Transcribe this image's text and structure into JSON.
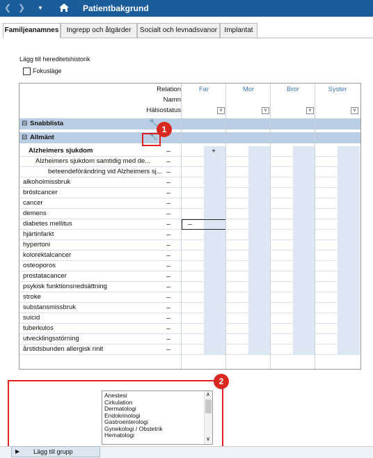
{
  "window": {
    "title": "Patientbakgrund"
  },
  "tabs": [
    {
      "label": "Familjeanamnes",
      "active": true
    },
    {
      "label": "Ingrepp och åtgärder"
    },
    {
      "label": "Socialt och levnadsvanor"
    },
    {
      "label": "Implantat"
    }
  ],
  "main": {
    "add_history_label": "Lägg till hereditetshistorik",
    "focus_mode_label": "Fokusläge"
  },
  "grid": {
    "header_labels": {
      "relation": "Relation",
      "name": "Namn",
      "health": "Hälsostatus"
    },
    "relations": [
      "Far",
      "Mor",
      "Bror",
      "Syster"
    ],
    "groups": {
      "quicklist": "Snabblista",
      "general": "Allmänt"
    },
    "rows": [
      {
        "label": "Alzheimers sjukdom",
        "bold": true,
        "indent": 0,
        "mark": "–",
        "far": "+"
      },
      {
        "label": "Alzheimers sjukdom samtidig med de...",
        "indent": 1,
        "mark": "–"
      },
      {
        "label": "beteendeförändring vid Alzheimers sj...",
        "indent": 2,
        "mark": "–"
      },
      {
        "label": "alkoholmissbruk",
        "mark": "–"
      },
      {
        "label": "bröstcancer",
        "mark": "–"
      },
      {
        "label": "cancer",
        "mark": "–"
      },
      {
        "label": "demens",
        "mark": "–"
      },
      {
        "label": "diabetes mellitus",
        "mark": "–",
        "far": "–",
        "selected": true
      },
      {
        "label": "hjärtinfarkt",
        "mark": "–"
      },
      {
        "label": "hypertoni",
        "mark": "–"
      },
      {
        "label": "kolorektalcancer",
        "mark": "–"
      },
      {
        "label": "osteoporos",
        "mark": "–"
      },
      {
        "label": "prostatacancer",
        "mark": "–"
      },
      {
        "label": "psykisk funktionsnedsättning",
        "mark": "–"
      },
      {
        "label": "stroke",
        "mark": "–"
      },
      {
        "label": "substansmissbruk",
        "mark": "–"
      },
      {
        "label": "suicid",
        "mark": "–"
      },
      {
        "label": "tuberkulos",
        "mark": "–"
      },
      {
        "label": "utvecklingsstörning",
        "mark": "–"
      },
      {
        "label": "årstidsbunden allergisk rinit",
        "mark": "–"
      }
    ]
  },
  "callouts": [
    {
      "number": "1"
    },
    {
      "number": "2"
    }
  ],
  "group_list": {
    "items": [
      "Anestesi",
      "Cirkulation",
      "Dermatologi",
      "Endokrinologi",
      "Gastroenterologi",
      "Gynekologi / Obstetrik",
      "Hematologi"
    ]
  },
  "footer": {
    "add_group_label": "Lägg till grupp"
  }
}
